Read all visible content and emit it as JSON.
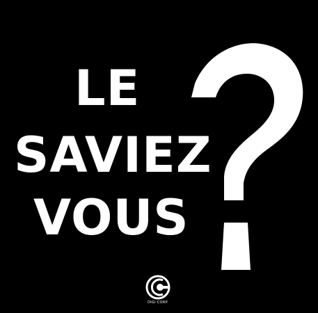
{
  "headline": {
    "line1": "LE",
    "line2": "SAVIEZ",
    "line3": "VOUS",
    "symbol": "?"
  },
  "logo": {
    "text": "DIGI CORP."
  },
  "colors": {
    "background": "#000000",
    "text": "#ffffff"
  }
}
